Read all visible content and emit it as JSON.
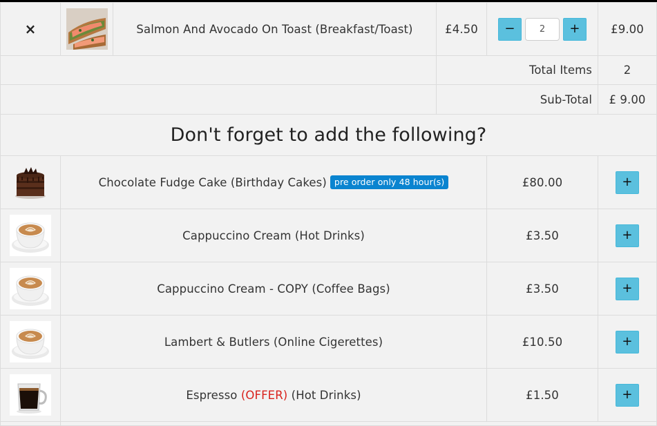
{
  "cart": {
    "item": {
      "remove_symbol": "×",
      "name": "Salmon And Avocado On Toast (Breakfast/Toast)",
      "unit_price": "£4.50",
      "decrement_label": "−",
      "quantity": "2",
      "increment_label": "+",
      "line_total": "£9.00"
    },
    "total_items_label": "Total Items",
    "total_items_value": "2",
    "subtotal_label": "Sub-Total",
    "subtotal_value": "£ 9.00"
  },
  "suggestions": {
    "heading": "Don't forget to add the following?",
    "add_label": "+",
    "items": [
      {
        "name": "Chocolate Fudge Cake (Birthday Cakes)",
        "badge": "pre order only 48 hour(s)",
        "price": "£80.00",
        "image": "cake-image"
      },
      {
        "name": "Cappuccino Cream (Hot Drinks)",
        "price": "£3.50",
        "image": "cappuccino-image"
      },
      {
        "name": "Cappuccino Cream - COPY (Coffee Bags)",
        "price": "£3.50",
        "image": "cappuccino-image"
      },
      {
        "name": "Lambert & Butlers (Online Cigerettes)",
        "price": "£10.50",
        "image": "cappuccino-image"
      },
      {
        "name_prefix": "Espresso",
        "offer": "(OFFER)",
        "name_suffix": "(Hot Drinks)",
        "price": "£1.50",
        "image": "espresso-image"
      }
    ]
  },
  "colors": {
    "button": "#5bc0de",
    "badge": "#0a84d0",
    "offer": "#d9221c"
  }
}
